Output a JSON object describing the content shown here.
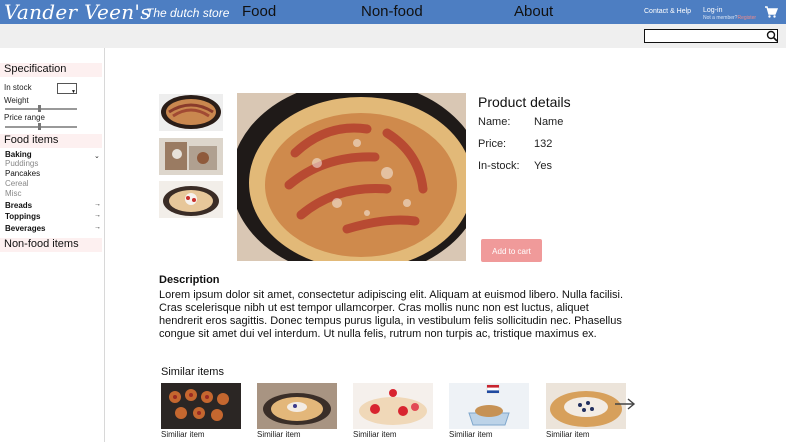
{
  "header": {
    "brand": "Vander Veen's",
    "tagline": "The dutch store",
    "contact_label": "Contact & Help",
    "login_label": "Log-in",
    "member_prefix": "Not a member?",
    "register_label": "Register",
    "cart_icon": "shopping-cart-icon"
  },
  "nav": {
    "items": [
      "Food",
      "Non-food",
      "About"
    ],
    "search_placeholder": ""
  },
  "sidebar": {
    "specification_label": "Specification",
    "in_stock_label": "In stock",
    "weight_label": "Weight",
    "price_range_label": "Price range",
    "weight_level": 0.48,
    "price_level": 0.48,
    "food_items_label": "Food items",
    "categories": [
      {
        "label": "Baking",
        "expanded": true,
        "items": [
          {
            "label": "Puddings",
            "active": false
          },
          {
            "label": "Pancakes",
            "active": true
          },
          {
            "label": "Cereal",
            "active": false
          },
          {
            "label": "Misc",
            "active": false
          }
        ]
      },
      {
        "label": "Breads",
        "expanded": false
      },
      {
        "label": "Toppings",
        "expanded": false
      },
      {
        "label": "Beverages",
        "expanded": false
      }
    ],
    "non_food_label": "Non-food items"
  },
  "product": {
    "details_title": "Product details",
    "name_key": "Name:",
    "name_value": "Name",
    "price_key": "Price:",
    "price_value": "132",
    "stock_key": "In-stock:",
    "stock_value": "Yes",
    "add_to_cart_label": "Add to cart"
  },
  "description": {
    "title": "Description",
    "text": "Lorem ipsum dolor sit amet, consectetur adipiscing elit. Aliquam at euismod libero. Nulla facilisi. Cras scelerisque nibh ut est tempor ullamcorper. Cras mollis nunc non est luctus, aliquet hendrerit eros sagittis. Donec tempus purus ligula, in vestibulum felis sollicitudin nec. Phasellus congue sit amet dui vel interdum. Ut nulla felis, rutrum non turpis ac, tristique maximus ex."
  },
  "similar": {
    "title": "Similar items",
    "items": [
      "Similiar item",
      "Similiar item",
      "Similiar item",
      "Similiar item",
      "Similiar item"
    ]
  },
  "colors": {
    "topbar": "#4d7ec2",
    "accent": "#f09a9a",
    "section_bg": "#fdf0f0"
  }
}
